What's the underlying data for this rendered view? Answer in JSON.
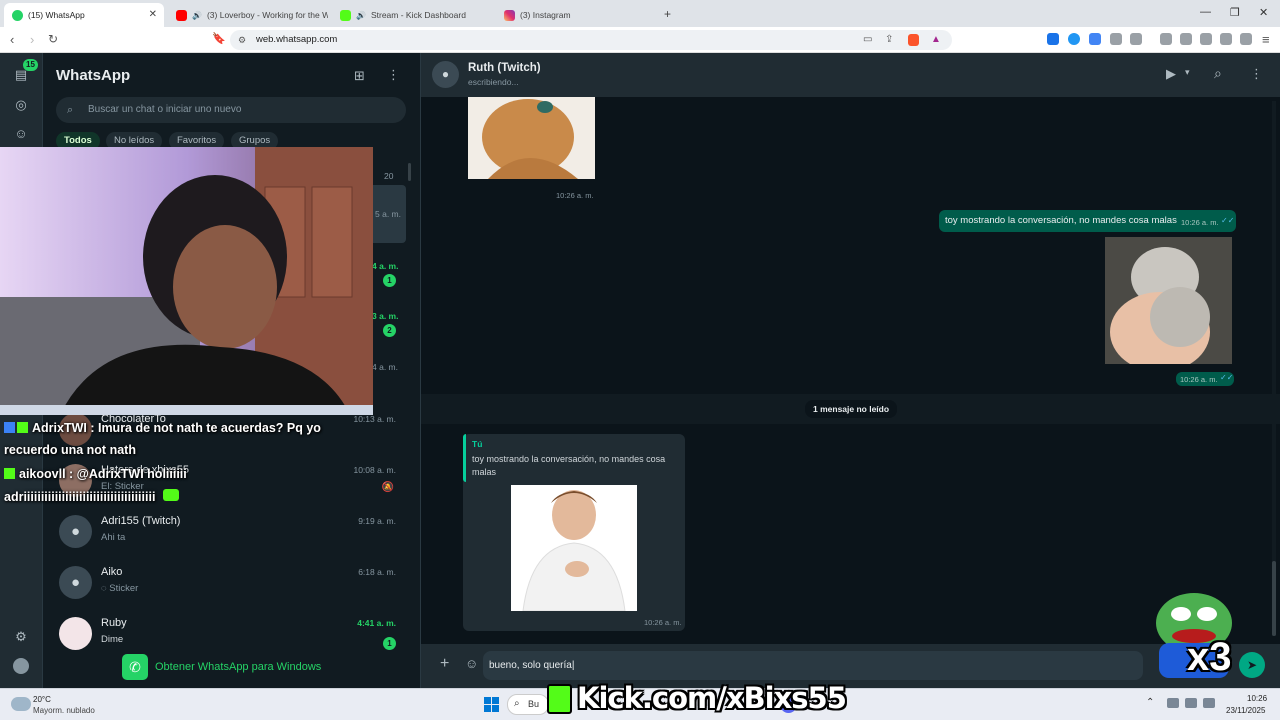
{
  "browser": {
    "tabs": [
      {
        "title": "(15) WhatsApp",
        "icon": "whatsapp-icon",
        "color": "#25d366",
        "active": true
      },
      {
        "title": "(3) Loverboy - Working for the W",
        "icon": "youtube-icon",
        "color": "#ff0000",
        "active": false
      },
      {
        "title": "Stream - Kick Dashboard",
        "icon": "kick-icon",
        "color": "#53fc18",
        "active": false
      },
      {
        "title": "(3) Instagram",
        "icon": "instagram-icon",
        "color": "#e1306c",
        "active": false
      }
    ],
    "address": "web.whatsapp.com"
  },
  "rail": {
    "badge": "15"
  },
  "sidebar": {
    "title": "WhatsApp",
    "search_placeholder": "Buscar un chat o iniciar uno nuevo",
    "filters": [
      "Todos",
      "No leídos",
      "Favoritos",
      "Grupos"
    ],
    "partial_time_top": "20",
    "partial_times": [
      "5 a. m.",
      "4 a. m.",
      "3 a. m.",
      "4 a. m."
    ],
    "partial_badges": [
      "1",
      "2"
    ],
    "chats": [
      {
        "name": "ChocolaterTo",
        "message": "",
        "time": "10:13 a. m."
      },
      {
        "name": "Haters de xbixs55",
        "message": "El: Sticker",
        "time": "10:08 a. m."
      },
      {
        "name": "Adri155 (Twitch)",
        "message": "Ahi ta",
        "time": "9:19 a. m."
      },
      {
        "name": "Aiko",
        "message": "Sticker",
        "time": "6:18 a. m."
      },
      {
        "name": "Ruby",
        "message": "Dime",
        "time": "4:41 a. m.",
        "badge": "1"
      }
    ],
    "get_app": "Obtener WhatsApp para Windows"
  },
  "stream_chat": {
    "line1": "AdrixTWI : Imura de not nath te acuerdas? Pq yo",
    "line2": "recuerdo una not nath",
    "line3": "aikoovll : @AdrixTWI holiiiiii",
    "line4": "adriiiiiiiiiiiiiiiiiiiiiiiiiiiiiiiiiiiiii"
  },
  "conversation": {
    "contact": "Ruth (Twitch)",
    "status": "escribiendo...",
    "msg1_time": "10:26 a. m.",
    "out_text": "toy mostrando la conversación, no mandes cosa malas",
    "out_text_time": "10:26 a. m.",
    "out_img_time": "10:26 a. m.",
    "unread": "1 mensaje no leído",
    "reply_author": "Tú",
    "reply_quote": "toy mostrando la conversación, no mandes cosa malas",
    "reply_time": "10:26 a. m.",
    "draft": "bueno, solo quería"
  },
  "taskbar": {
    "temp": "20°C",
    "weather": "Mayorm. nublado",
    "search_stub": "Bu",
    "time": "10:26",
    "date": "23/11/2025",
    "overlay_text": "Kick.com/xBixs55",
    "multiplier": "x3"
  },
  "colors": {
    "accent": "#25d366",
    "outgoing": "#005c4b",
    "incoming": "#202c33",
    "bg": "#0b141a",
    "kick": "#53fc18"
  }
}
